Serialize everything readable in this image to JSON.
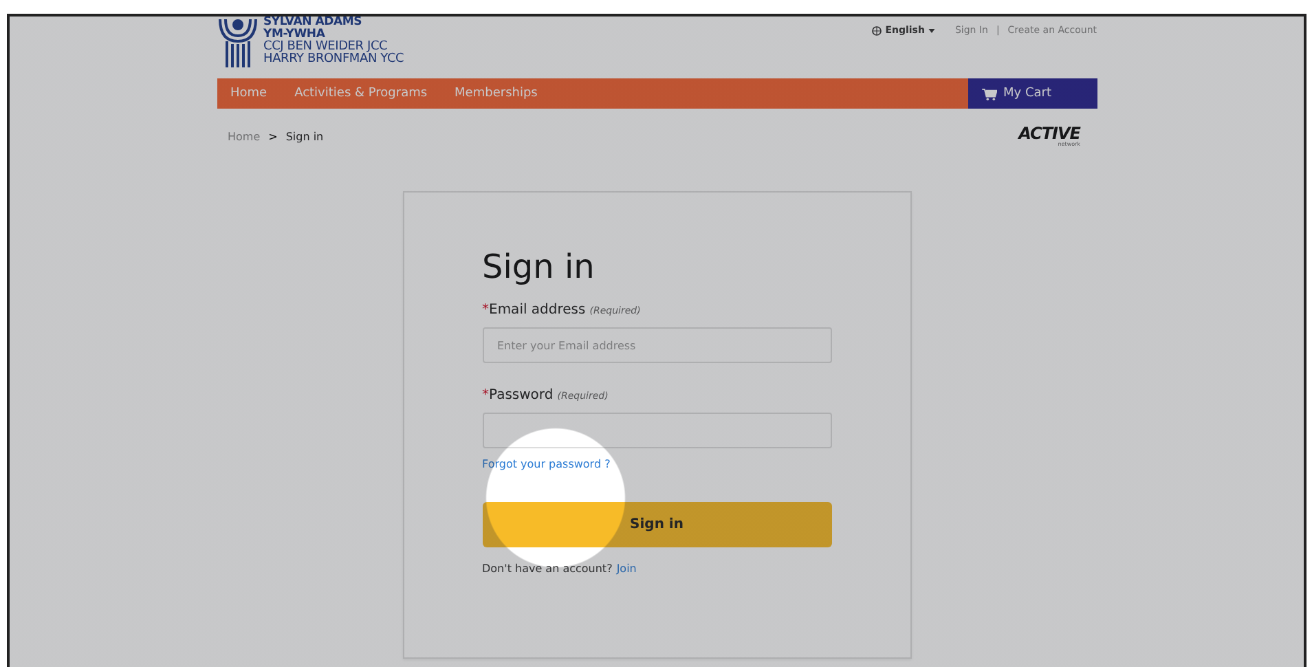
{
  "header": {
    "logo_lines": [
      {
        "text": "SYLVAN ADAMS",
        "bold": true
      },
      {
        "text": "YM-YWHA",
        "bold": true
      },
      {
        "text": "CCJ BEN WEIDER JCC",
        "bold": false
      },
      {
        "text": "HARRY BRONFMAN YCC",
        "bold": false
      }
    ],
    "language": "English",
    "top_links": [
      "Sign In",
      "Create an Account"
    ],
    "separator": "|"
  },
  "nav": {
    "items": [
      "Home",
      "Activities & Programs",
      "Memberships"
    ],
    "cart": "My Cart"
  },
  "breadcrumb": {
    "items": [
      "Home",
      "Sign in"
    ],
    "separator": ">"
  },
  "partner_logo": {
    "name": "ACTIVE",
    "sub": "network"
  },
  "form": {
    "title": "Sign in",
    "fields": [
      {
        "required_mark": "*",
        "label": "Email address",
        "required_note": "(Required)",
        "placeholder": "Enter your Email address"
      },
      {
        "required_mark": "*",
        "label": "Password",
        "required_note": "(Required)"
      }
    ],
    "forgot_link": "Forgot your password ?",
    "submit": "Sign in",
    "signup_text": "Don't have an account?",
    "signup_link": "Join"
  },
  "spotlight": {
    "on": true
  }
}
